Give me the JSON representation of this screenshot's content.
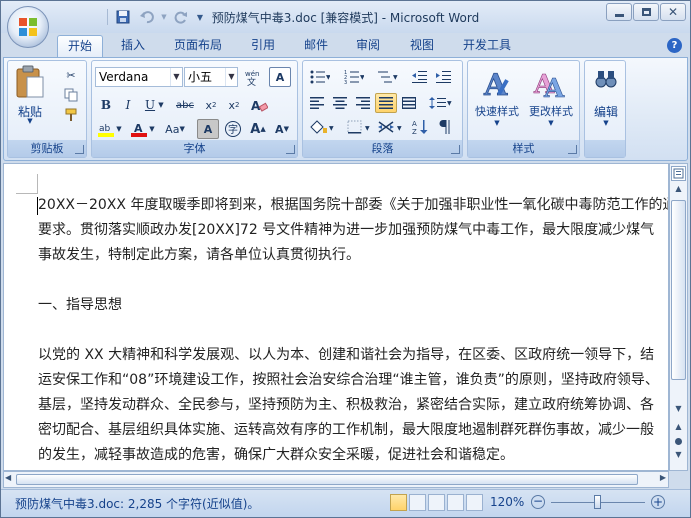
{
  "window": {
    "title": "预防煤气中毒3.doc [兼容模式] - Microsoft Word"
  },
  "tabs": [
    "开始",
    "插入",
    "页面布局",
    "引用",
    "邮件",
    "审阅",
    "视图",
    "开发工具"
  ],
  "active_tab": "开始",
  "ribbon": {
    "clipboard": {
      "label": "剪贴板",
      "paste": "粘贴"
    },
    "font": {
      "label": "字体",
      "name": "Verdana",
      "size": "小五"
    },
    "paragraph": {
      "label": "段落"
    },
    "styles": {
      "label": "样式",
      "quick_styles": "快速样式",
      "change_styles": "更改样式"
    },
    "editing": {
      "label": "编辑",
      "edit": "编辑"
    }
  },
  "document": {
    "paragraphs": [
      "20XX－20XX 年度取暖季即将到来，根据国务院十部委《关于加强非职业性一氧化碳中毒防范工作的通",
      "要求。贯彻落实顺政办发[20XX]72 号文件精神为进一步加强预防煤气中毒工作，最大限度减少煤气",
      "事故发生，特制定此方案，请各单位认真贯彻执行。",
      "",
      "一、指导思想",
      "",
      "以党的 XX 大精神和科学发展观、以人为本、创建和谐社会为指导，在区委、区政府统一领导下，结",
      "运安保工作和“08”环境建设工作，按照社会治安综合治理“谁主管，谁负责”的原则，坚持政府领导、",
      "基层，坚持发动群众、全民参与，坚持预防为主、积极救治，紧密结合实际，建立政府统筹协调、各",
      "密切配合、基层组织具体实施、运转高效有序的工作机制，最大限度地遏制群死群伤事故，减少一般",
      "的发生，减轻事故造成的危害，确保广大群众安全采暖，促进社会和谐稳定。"
    ]
  },
  "status": {
    "doc_info": "预防煤气中毒3.doc: 2,285 个字符(近似值)。",
    "zoom": "120%"
  }
}
